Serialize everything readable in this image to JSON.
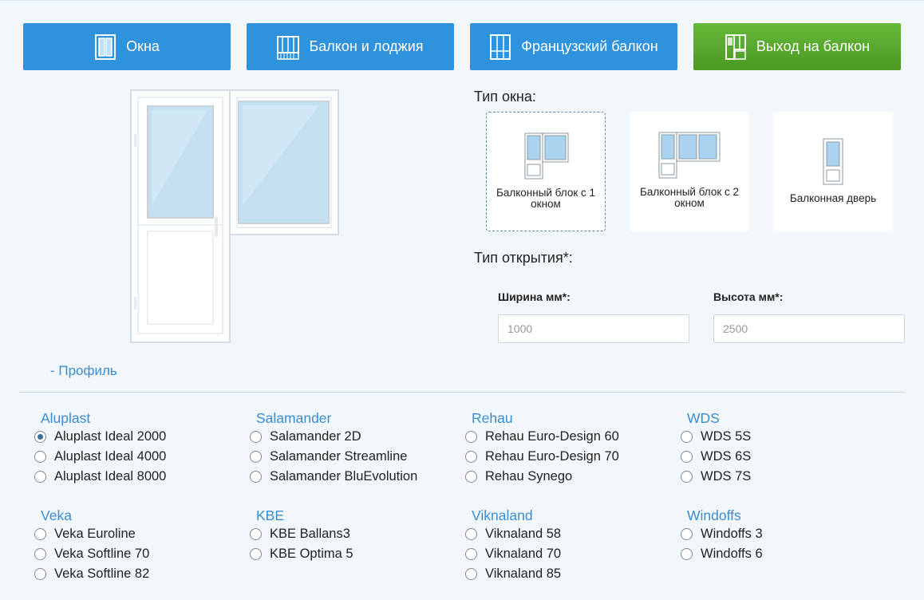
{
  "tabs": [
    {
      "label": "Окна",
      "icon": "window-single-icon",
      "active": false
    },
    {
      "label": "Балкон и лоджия",
      "icon": "balcony-icon",
      "active": false
    },
    {
      "label": "Французский балкон",
      "icon": "french-balcony-icon",
      "active": false
    },
    {
      "label": "Выход на балкон",
      "icon": "balcony-door-icon",
      "active": true
    }
  ],
  "window_type": {
    "label": "Тип окна:",
    "options": [
      {
        "label": "Балконный блок с 1 окном",
        "icon": "balcony-block-1-icon",
        "selected": true
      },
      {
        "label": "Балконный блок с 2 окном",
        "icon": "balcony-block-2-icon",
        "selected": false
      },
      {
        "label": "Балконная дверь",
        "icon": "balcony-door-only-icon",
        "selected": false
      }
    ]
  },
  "opening_type": {
    "label": "Тип открытия*:"
  },
  "width": {
    "label": "Ширина мм*:",
    "placeholder": "1000",
    "value": ""
  },
  "height": {
    "label": "Высота мм*:",
    "placeholder": "2500",
    "value": ""
  },
  "profile_toggle": "-  Профиль",
  "profiles": [
    {
      "brand": "Aluplast",
      "options": [
        "Aluplast Ideal 2000",
        "Aluplast Ideal 4000",
        "Aluplast Ideal 8000"
      ]
    },
    {
      "brand": "Salamander",
      "options": [
        "Salamander 2D",
        "Salamander Streamline",
        "Salamander BluEvolution"
      ]
    },
    {
      "brand": "Rehau",
      "options": [
        "Rehau Euro-Design 60",
        "Rehau Euro-Design 70",
        "Rehau Synego"
      ]
    },
    {
      "brand": "WDS",
      "options": [
        "WDS 5S",
        "WDS 6S",
        "WDS 7S"
      ]
    },
    {
      "brand": "Veka",
      "options": [
        "Veka Euroline",
        "Veka Softline 70",
        "Veka Softline 82"
      ]
    },
    {
      "brand": "KBE",
      "options": [
        "KBE Ballans3",
        "KBE Optima 5"
      ]
    },
    {
      "brand": "Viknaland",
      "options": [
        "Viknaland 58",
        "Viknaland 70",
        "Viknaland 85"
      ]
    },
    {
      "brand": "Windoffs",
      "options": [
        "Windoffs 3",
        "Windoffs 6"
      ]
    }
  ],
  "selected_profile": "Aluplast Ideal 2000",
  "colors": {
    "tab_blue": "#2e92dc",
    "tab_green": "#5aaa2e",
    "link_blue": "#3a8cd3"
  }
}
